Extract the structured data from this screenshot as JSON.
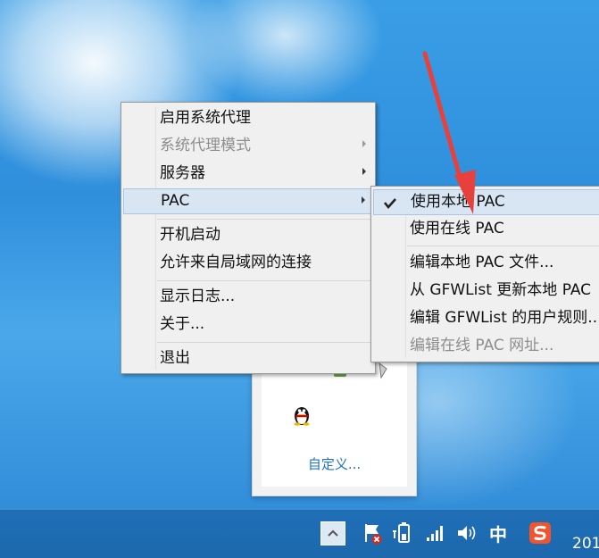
{
  "main_menu": {
    "items": [
      {
        "label": "启用系统代理",
        "enabled": true,
        "has_submenu": false
      },
      {
        "label": "系统代理模式",
        "enabled": false,
        "has_submenu": true
      },
      {
        "label": "服务器",
        "enabled": true,
        "has_submenu": true
      },
      {
        "label": "PAC",
        "enabled": true,
        "has_submenu": true,
        "highlighted": true
      },
      {
        "label": "开机启动",
        "enabled": true,
        "has_submenu": false
      },
      {
        "label": "允许来自局域网的连接",
        "enabled": true,
        "has_submenu": false
      },
      {
        "label": "显示日志...",
        "enabled": true,
        "has_submenu": false
      },
      {
        "label": "关于...",
        "enabled": true,
        "has_submenu": false
      },
      {
        "label": "退出",
        "enabled": true,
        "has_submenu": false
      }
    ]
  },
  "pac_submenu": {
    "items": [
      {
        "label": "使用本地 PAC",
        "checked": true,
        "enabled": true
      },
      {
        "label": "使用在线 PAC",
        "checked": false,
        "enabled": true
      },
      {
        "label": "编辑本地 PAC 文件...",
        "enabled": true
      },
      {
        "label": "从 GFWList 更新本地 PAC",
        "enabled": true
      },
      {
        "label": "编辑 GFWList 的用户规则...",
        "enabled": true
      },
      {
        "label": "编辑在线 PAC 网址...",
        "enabled": false
      }
    ]
  },
  "tray_popup": {
    "customize_label": "自定义..."
  },
  "taskbar": {
    "ime_label": "中",
    "clock_partial": "201"
  },
  "colors": {
    "menu_bg": "#f0f0f0",
    "menu_highlight": "#d8e6f4",
    "annotation_arrow": "#e8403a",
    "taskbar": "#1f6fb7",
    "link": "#1f72c4"
  },
  "icons": [
    "qq-penguin-icon",
    "notification-flag-icon",
    "battery-icon",
    "network-signal-icon",
    "volume-icon",
    "sogou-ime-icon",
    "show-hidden-icons-chevron-icon",
    "check-icon"
  ]
}
